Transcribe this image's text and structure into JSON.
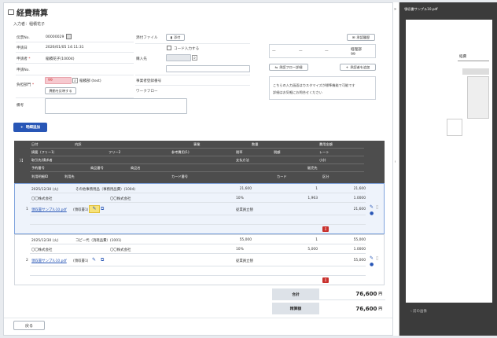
{
  "header": {
    "title": "経費精算",
    "entrant": "入力者：稲積花子"
  },
  "form": {
    "application_no_label": "伝票No.",
    "application_no": "00000029",
    "date_label": "申請日",
    "date": "2026/01/05 14:11:31",
    "applicant_label": "申請者",
    "applicant_required": "*",
    "applicant": "稲積花子(10004)",
    "request_no_label": "申請No.",
    "dept_label": "負担部門",
    "dept_required": "*",
    "dept_code": "99",
    "dept_name": "稲積部 (test)",
    "dept_all_button": "異動を反映する",
    "remarks_label": "備考",
    "attach_label": "添付ファイル",
    "attach_button": "添付",
    "code_input_label": "コード入力する",
    "vendor_label": "購入先",
    "invoice_label": "事業者登録番号",
    "workflow_label": "ワークフロー"
  },
  "approval": {
    "history_button": "承認履歴",
    "cols": [
      "—",
      "—",
      "—",
      "経理部"
    ],
    "cell_num": "99",
    "flow_button": "承認フロー詳細",
    "add_button": "承認者を追加",
    "note1": "こちらの入力画面はカスタマイズが標準機能で可能です",
    "note2": "詳細はお気軽にお問合せください"
  },
  "add_detail_button": "明細追加",
  "table": {
    "h1": [
      "日付",
      "内訳",
      "",
      "事業",
      "数量",
      "",
      "費用金額"
    ],
    "h2": [
      "摘要（フリー1）",
      "フリー2",
      "参考費用(1)",
      "税率",
      "税額",
      "レート"
    ],
    "h3": [
      "取引先/請求者",
      "",
      "",
      "支払方法",
      "小計"
    ],
    "h4": [
      "予約番号",
      "商品番号",
      "商品名",
      "販売先"
    ],
    "h5": [
      "利用明細ID",
      "利用先",
      "カード番号",
      "カード",
      "区分"
    ]
  },
  "rows": [
    {
      "no": "1",
      "date": "2025/12/30 (火)",
      "item": "その他事務用品（事務用品費）(1004)",
      "amount": "21,600",
      "qty": "1",
      "total": "21,600",
      "vendor1": "〇〇株式会社",
      "vendor2": "〇〇株式会社",
      "tax": "10%",
      "tax_amount": "1,963",
      "rate": "1.0000",
      "file": "領収書サンプル10.pdf",
      "file_suffix": "(領収書1)",
      "payment": "従業員立替",
      "subtotal": "21,600"
    },
    {
      "no": "2",
      "date": "2025/12/30 (火)",
      "item": "コピー代（消耗品費）(1001)",
      "amount": "55,000",
      "qty": "1",
      "total": "55,000",
      "vendor1": "〇〇株式会社",
      "vendor2": "〇〇株式会社",
      "tax": "10%",
      "tax_amount": "5,000",
      "rate": "1.0000",
      "file": "領収書サンプル10.pdf",
      "file_suffix": "(領収書1)",
      "payment": "従業員立替",
      "subtotal": "55,000"
    }
  ],
  "totals": {
    "sum_label": "合計",
    "sum_value": "76,600",
    "sum_unit": "円",
    "settle_label": "精算額",
    "settle_value": "76,600",
    "settle_unit": "円"
  },
  "footer": {
    "back_button": "戻る"
  },
  "preview": {
    "filename": "領収書サンプル10.pdf",
    "text1": "経費",
    "prev_page": "前の画像"
  }
}
